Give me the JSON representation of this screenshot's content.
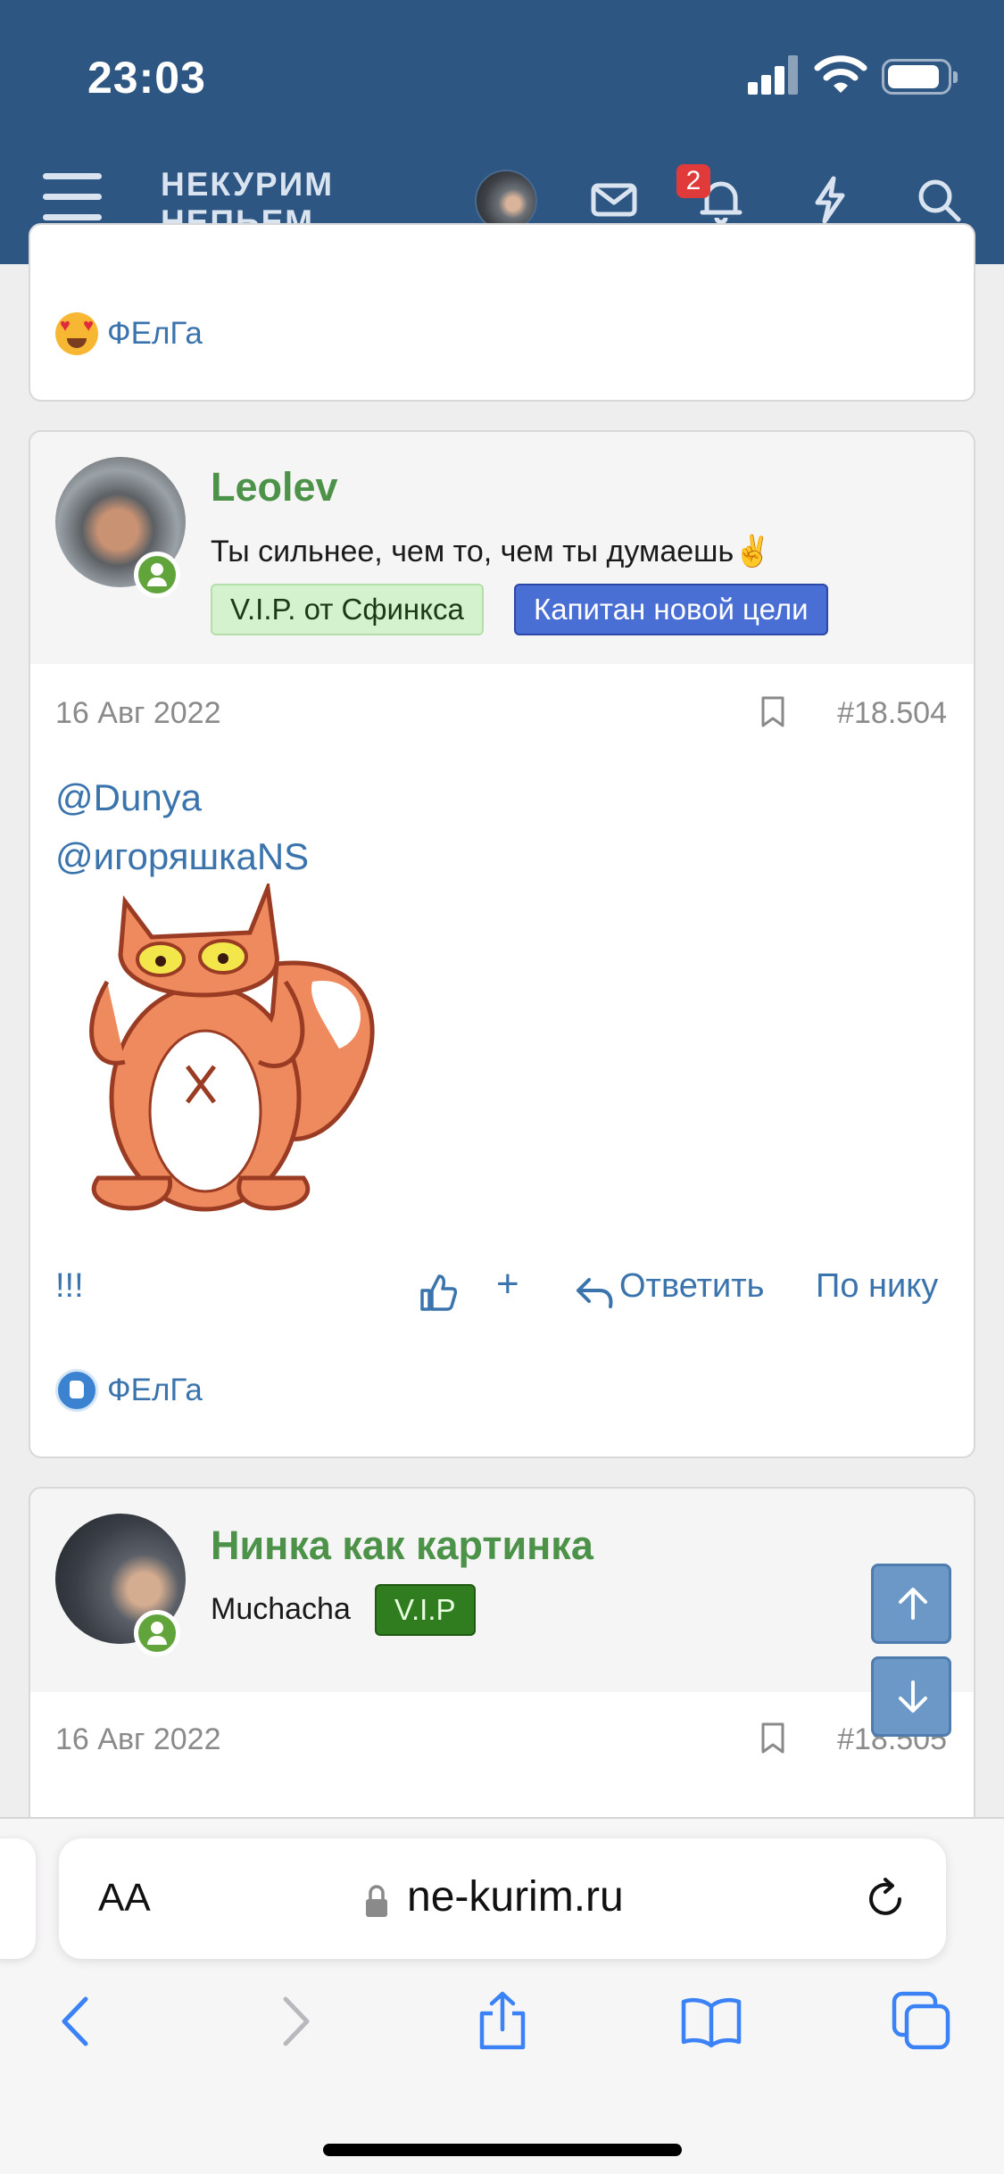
{
  "status_bar": {
    "time": "23:03"
  },
  "header": {
    "logo_line1": "НЕКУРИМ",
    "logo_line2": "НЕПЬЕМ...",
    "alerts_count": "2"
  },
  "prev_post": {
    "reaction_user": "ФЕлГа"
  },
  "post1": {
    "author": "Leolev",
    "user_title": "Ты сильнее, чем то, чем ты думаешь✌️",
    "badges": [
      "V.I.P. от Сфинкса",
      "Капитан новой цели"
    ],
    "date": "16 Авг 2022",
    "number": "#18.504",
    "mentions": [
      "@Dunya",
      "@игоряшкаNS"
    ],
    "text": "!!!",
    "actions": {
      "plus": "+",
      "reply": "Ответить",
      "by_nick": "По нику"
    },
    "reaction_user": "ФЕлГа"
  },
  "post2": {
    "author": "Нинка как картинка",
    "user_title": "Muchacha",
    "badge": "V.I.P",
    "date": "16 Авг 2022",
    "number": "#18.505"
  },
  "browser": {
    "aa_label": "AA",
    "url": "ne-kurim.ru"
  },
  "colors": {
    "header": "#2e5683",
    "link": "#3b74ad",
    "username": "#4c9249"
  }
}
